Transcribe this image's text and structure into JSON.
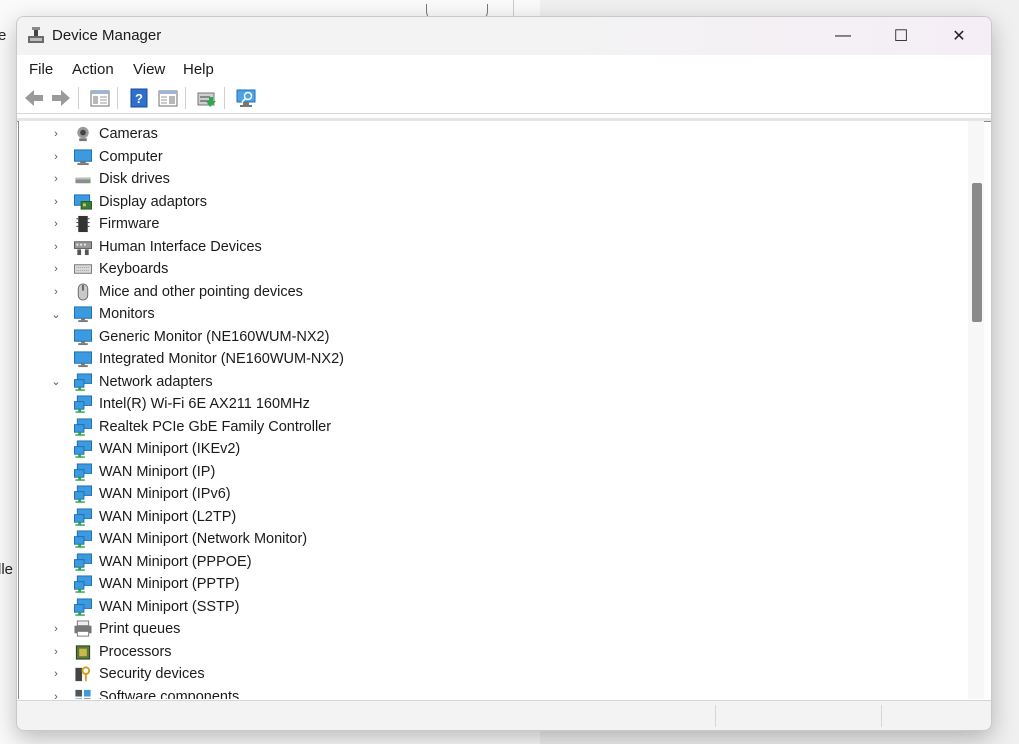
{
  "background": {
    "fragment_top": "e",
    "fragment_mid": "lle"
  },
  "window": {
    "title": "Device Manager",
    "controls": {
      "minimize": "—",
      "maximize": "☐",
      "close": "✕"
    }
  },
  "menu": [
    "File",
    "Action",
    "View",
    "Help"
  ],
  "toolbar": [
    "back-icon",
    "forward-icon",
    "show-hide-console-tree-icon",
    "help-icon",
    "properties-icon",
    "update-driver-icon",
    "scan-hardware-icon"
  ],
  "tree": [
    {
      "label": "Cameras",
      "level": 0,
      "expander": "›",
      "icon": "camera-icon"
    },
    {
      "label": "Computer",
      "level": 0,
      "expander": "›",
      "icon": "computer-icon"
    },
    {
      "label": "Disk drives",
      "level": 0,
      "expander": "›",
      "icon": "disk-drive-icon"
    },
    {
      "label": "Display adaptors",
      "level": 0,
      "expander": "›",
      "icon": "display-adapter-icon"
    },
    {
      "label": "Firmware",
      "level": 0,
      "expander": "›",
      "icon": "firmware-icon"
    },
    {
      "label": "Human Interface Devices",
      "level": 0,
      "expander": "›",
      "icon": "hid-icon"
    },
    {
      "label": "Keyboards",
      "level": 0,
      "expander": "›",
      "icon": "keyboard-icon"
    },
    {
      "label": "Mice and other pointing devices",
      "level": 0,
      "expander": "›",
      "icon": "mouse-icon"
    },
    {
      "label": "Monitors",
      "level": 0,
      "expander": "⌄",
      "icon": "monitor-icon"
    },
    {
      "label": "Generic Monitor (NE160WUM-NX2)",
      "level": 1,
      "expander": "",
      "icon": "monitor-icon"
    },
    {
      "label": "Integrated Monitor (NE160WUM-NX2)",
      "level": 1,
      "expander": "",
      "icon": "monitor-icon"
    },
    {
      "label": "Network adapters",
      "level": 0,
      "expander": "⌄",
      "icon": "network-adapter-icon"
    },
    {
      "label": "Intel(R) Wi-Fi 6E AX211 160MHz",
      "level": 1,
      "expander": "",
      "icon": "network-adapter-icon"
    },
    {
      "label": "Realtek PCIe GbE Family Controller",
      "level": 1,
      "expander": "",
      "icon": "network-adapter-icon"
    },
    {
      "label": "WAN Miniport (IKEv2)",
      "level": 1,
      "expander": "",
      "icon": "network-adapter-icon"
    },
    {
      "label": "WAN Miniport (IP)",
      "level": 1,
      "expander": "",
      "icon": "network-adapter-icon"
    },
    {
      "label": "WAN Miniport (IPv6)",
      "level": 1,
      "expander": "",
      "icon": "network-adapter-icon"
    },
    {
      "label": "WAN Miniport (L2TP)",
      "level": 1,
      "expander": "",
      "icon": "network-adapter-icon"
    },
    {
      "label": "WAN Miniport (Network Monitor)",
      "level": 1,
      "expander": "",
      "icon": "network-adapter-icon"
    },
    {
      "label": "WAN Miniport (PPPOE)",
      "level": 1,
      "expander": "",
      "icon": "network-adapter-icon"
    },
    {
      "label": "WAN Miniport (PPTP)",
      "level": 1,
      "expander": "",
      "icon": "network-adapter-icon"
    },
    {
      "label": "WAN Miniport (SSTP)",
      "level": 1,
      "expander": "",
      "icon": "network-adapter-icon"
    },
    {
      "label": "Print queues",
      "level": 0,
      "expander": "›",
      "icon": "printer-icon"
    },
    {
      "label": "Processors",
      "level": 0,
      "expander": "›",
      "icon": "processor-icon"
    },
    {
      "label": "Security devices",
      "level": 0,
      "expander": "›",
      "icon": "security-device-icon"
    },
    {
      "label": "Software components",
      "level": 0,
      "expander": "›",
      "icon": "software-component-icon"
    }
  ],
  "scrollbar": {
    "position": 0.12,
    "visible_fraction": 0.24
  }
}
